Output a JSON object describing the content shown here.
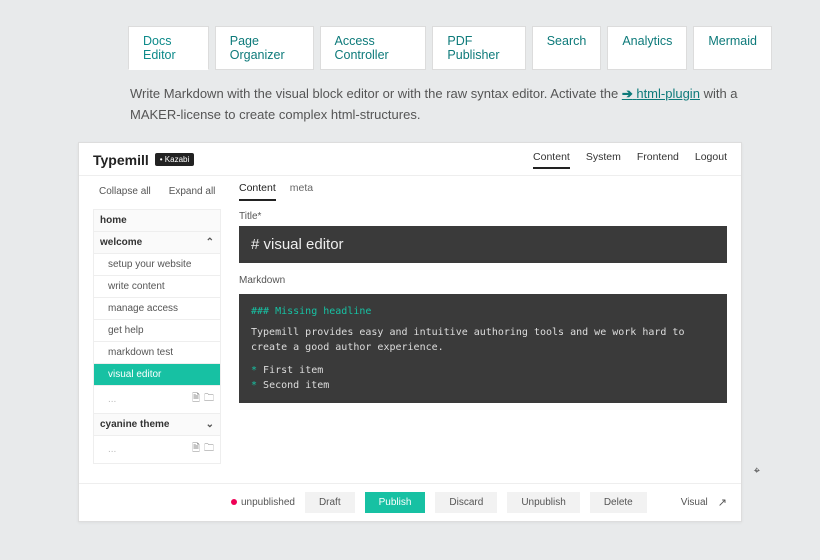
{
  "tabs": [
    "Docs Editor",
    "Page Organizer",
    "Access Controller",
    "PDF Publisher",
    "Search",
    "Analytics",
    "Mermaid"
  ],
  "desc": {
    "pre": "Write Markdown with the visual block editor or with the raw syntax editor. Activate the ",
    "link": "html-plugin",
    "post": " with a MAKER-license to create complex html-structures."
  },
  "brand": {
    "name": "Typemill",
    "badge": "• Kazabi"
  },
  "topnav": [
    "Content",
    "System",
    "Frontend",
    "Logout"
  ],
  "tree_actions": [
    "Collapse all",
    "Expand all"
  ],
  "content_tabs": [
    "Content",
    "meta"
  ],
  "tree": {
    "home": "home",
    "welcome": "welcome",
    "items": [
      "setup your website",
      "write content",
      "manage access",
      "get help",
      "markdown test",
      "visual editor"
    ],
    "placeholder": "...",
    "cyanine": "cyanine theme"
  },
  "editor": {
    "title_label": "Title*",
    "title_value": "# visual editor",
    "md_label": "Markdown",
    "md_heading": "### Missing headline",
    "md_body": "Typemill provides easy and intuitive authoring tools and we work hard to create a good author experience.",
    "md_item1": "First item",
    "md_item2": "Second item"
  },
  "footer": {
    "status": "unpublished",
    "draft": "Draft",
    "publish": "Publish",
    "discard": "Discard",
    "unpublish": "Unpublish",
    "delete": "Delete",
    "visual": "Visual"
  }
}
